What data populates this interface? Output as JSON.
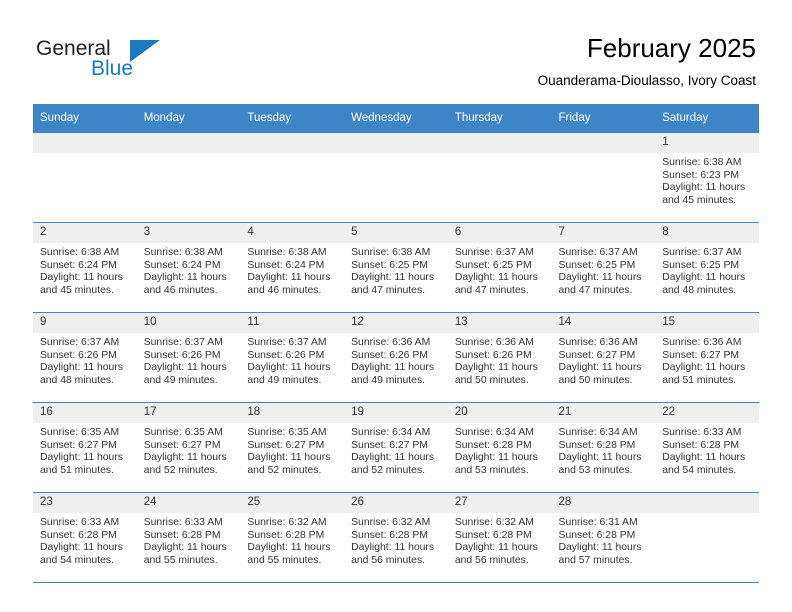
{
  "logo": {
    "word_top": "General",
    "word_bottom": "Blue",
    "accent_color": "#1c79c0"
  },
  "header": {
    "title": "February 2025",
    "subtitle": "Ouanderama-Dioulasso, Ivory Coast"
  },
  "theme": {
    "header_bg": "#3d85c6",
    "daynum_bg": "#efefef",
    "text": "#333333"
  },
  "calendar": {
    "weekday_headers": [
      "Sunday",
      "Monday",
      "Tuesday",
      "Wednesday",
      "Thursday",
      "Friday",
      "Saturday"
    ],
    "weeks": [
      [
        {
          "day": "",
          "blank": true,
          "sunrise": "",
          "sunset": "",
          "daylight1": "",
          "daylight2": ""
        },
        {
          "day": "",
          "blank": true,
          "sunrise": "",
          "sunset": "",
          "daylight1": "",
          "daylight2": ""
        },
        {
          "day": "",
          "blank": true,
          "sunrise": "",
          "sunset": "",
          "daylight1": "",
          "daylight2": ""
        },
        {
          "day": "",
          "blank": true,
          "sunrise": "",
          "sunset": "",
          "daylight1": "",
          "daylight2": ""
        },
        {
          "day": "",
          "blank": true,
          "sunrise": "",
          "sunset": "",
          "daylight1": "",
          "daylight2": ""
        },
        {
          "day": "",
          "blank": true,
          "sunrise": "",
          "sunset": "",
          "daylight1": "",
          "daylight2": ""
        },
        {
          "day": "1",
          "blank": false,
          "sunrise": "Sunrise: 6:38 AM",
          "sunset": "Sunset: 6:23 PM",
          "daylight1": "Daylight: 11 hours",
          "daylight2": "and 45 minutes."
        }
      ],
      [
        {
          "day": "2",
          "blank": false,
          "sunrise": "Sunrise: 6:38 AM",
          "sunset": "Sunset: 6:24 PM",
          "daylight1": "Daylight: 11 hours",
          "daylight2": "and 45 minutes."
        },
        {
          "day": "3",
          "blank": false,
          "sunrise": "Sunrise: 6:38 AM",
          "sunset": "Sunset: 6:24 PM",
          "daylight1": "Daylight: 11 hours",
          "daylight2": "and 46 minutes."
        },
        {
          "day": "4",
          "blank": false,
          "sunrise": "Sunrise: 6:38 AM",
          "sunset": "Sunset: 6:24 PM",
          "daylight1": "Daylight: 11 hours",
          "daylight2": "and 46 minutes."
        },
        {
          "day": "5",
          "blank": false,
          "sunrise": "Sunrise: 6:38 AM",
          "sunset": "Sunset: 6:25 PM",
          "daylight1": "Daylight: 11 hours",
          "daylight2": "and 47 minutes."
        },
        {
          "day": "6",
          "blank": false,
          "sunrise": "Sunrise: 6:37 AM",
          "sunset": "Sunset: 6:25 PM",
          "daylight1": "Daylight: 11 hours",
          "daylight2": "and 47 minutes."
        },
        {
          "day": "7",
          "blank": false,
          "sunrise": "Sunrise: 6:37 AM",
          "sunset": "Sunset: 6:25 PM",
          "daylight1": "Daylight: 11 hours",
          "daylight2": "and 47 minutes."
        },
        {
          "day": "8",
          "blank": false,
          "sunrise": "Sunrise: 6:37 AM",
          "sunset": "Sunset: 6:25 PM",
          "daylight1": "Daylight: 11 hours",
          "daylight2": "and 48 minutes."
        }
      ],
      [
        {
          "day": "9",
          "blank": false,
          "sunrise": "Sunrise: 6:37 AM",
          "sunset": "Sunset: 6:26 PM",
          "daylight1": "Daylight: 11 hours",
          "daylight2": "and 48 minutes."
        },
        {
          "day": "10",
          "blank": false,
          "sunrise": "Sunrise: 6:37 AM",
          "sunset": "Sunset: 6:26 PM",
          "daylight1": "Daylight: 11 hours",
          "daylight2": "and 49 minutes."
        },
        {
          "day": "11",
          "blank": false,
          "sunrise": "Sunrise: 6:37 AM",
          "sunset": "Sunset: 6:26 PM",
          "daylight1": "Daylight: 11 hours",
          "daylight2": "and 49 minutes."
        },
        {
          "day": "12",
          "blank": false,
          "sunrise": "Sunrise: 6:36 AM",
          "sunset": "Sunset: 6:26 PM",
          "daylight1": "Daylight: 11 hours",
          "daylight2": "and 49 minutes."
        },
        {
          "day": "13",
          "blank": false,
          "sunrise": "Sunrise: 6:36 AM",
          "sunset": "Sunset: 6:26 PM",
          "daylight1": "Daylight: 11 hours",
          "daylight2": "and 50 minutes."
        },
        {
          "day": "14",
          "blank": false,
          "sunrise": "Sunrise: 6:36 AM",
          "sunset": "Sunset: 6:27 PM",
          "daylight1": "Daylight: 11 hours",
          "daylight2": "and 50 minutes."
        },
        {
          "day": "15",
          "blank": false,
          "sunrise": "Sunrise: 6:36 AM",
          "sunset": "Sunset: 6:27 PM",
          "daylight1": "Daylight: 11 hours",
          "daylight2": "and 51 minutes."
        }
      ],
      [
        {
          "day": "16",
          "blank": false,
          "sunrise": "Sunrise: 6:35 AM",
          "sunset": "Sunset: 6:27 PM",
          "daylight1": "Daylight: 11 hours",
          "daylight2": "and 51 minutes."
        },
        {
          "day": "17",
          "blank": false,
          "sunrise": "Sunrise: 6:35 AM",
          "sunset": "Sunset: 6:27 PM",
          "daylight1": "Daylight: 11 hours",
          "daylight2": "and 52 minutes."
        },
        {
          "day": "18",
          "blank": false,
          "sunrise": "Sunrise: 6:35 AM",
          "sunset": "Sunset: 6:27 PM",
          "daylight1": "Daylight: 11 hours",
          "daylight2": "and 52 minutes."
        },
        {
          "day": "19",
          "blank": false,
          "sunrise": "Sunrise: 6:34 AM",
          "sunset": "Sunset: 6:27 PM",
          "daylight1": "Daylight: 11 hours",
          "daylight2": "and 52 minutes."
        },
        {
          "day": "20",
          "blank": false,
          "sunrise": "Sunrise: 6:34 AM",
          "sunset": "Sunset: 6:28 PM",
          "daylight1": "Daylight: 11 hours",
          "daylight2": "and 53 minutes."
        },
        {
          "day": "21",
          "blank": false,
          "sunrise": "Sunrise: 6:34 AM",
          "sunset": "Sunset: 6:28 PM",
          "daylight1": "Daylight: 11 hours",
          "daylight2": "and 53 minutes."
        },
        {
          "day": "22",
          "blank": false,
          "sunrise": "Sunrise: 6:33 AM",
          "sunset": "Sunset: 6:28 PM",
          "daylight1": "Daylight: 11 hours",
          "daylight2": "and 54 minutes."
        }
      ],
      [
        {
          "day": "23",
          "blank": false,
          "sunrise": "Sunrise: 6:33 AM",
          "sunset": "Sunset: 6:28 PM",
          "daylight1": "Daylight: 11 hours",
          "daylight2": "and 54 minutes."
        },
        {
          "day": "24",
          "blank": false,
          "sunrise": "Sunrise: 6:33 AM",
          "sunset": "Sunset: 6:28 PM",
          "daylight1": "Daylight: 11 hours",
          "daylight2": "and 55 minutes."
        },
        {
          "day": "25",
          "blank": false,
          "sunrise": "Sunrise: 6:32 AM",
          "sunset": "Sunset: 6:28 PM",
          "daylight1": "Daylight: 11 hours",
          "daylight2": "and 55 minutes."
        },
        {
          "day": "26",
          "blank": false,
          "sunrise": "Sunrise: 6:32 AM",
          "sunset": "Sunset: 6:28 PM",
          "daylight1": "Daylight: 11 hours",
          "daylight2": "and 56 minutes."
        },
        {
          "day": "27",
          "blank": false,
          "sunrise": "Sunrise: 6:32 AM",
          "sunset": "Sunset: 6:28 PM",
          "daylight1": "Daylight: 11 hours",
          "daylight2": "and 56 minutes."
        },
        {
          "day": "28",
          "blank": false,
          "sunrise": "Sunrise: 6:31 AM",
          "sunset": "Sunset: 6:28 PM",
          "daylight1": "Daylight: 11 hours",
          "daylight2": "and 57 minutes."
        },
        {
          "day": "",
          "blank": true,
          "sunrise": "",
          "sunset": "",
          "daylight1": "",
          "daylight2": ""
        }
      ]
    ]
  }
}
